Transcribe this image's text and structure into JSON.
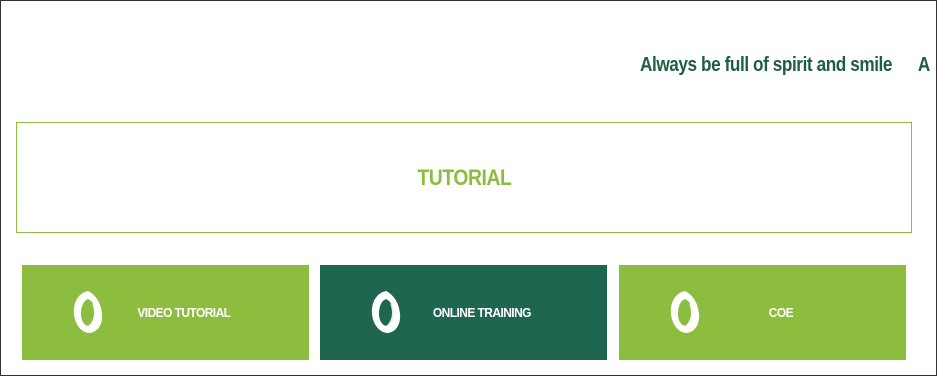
{
  "colors": {
    "accent_green": "#8cbd3f",
    "dark_green": "#1f6650",
    "ticker_text": "#1f5e40",
    "border_gray": "#333333"
  },
  "ticker": {
    "text": "Always be full of spirit and smile",
    "overflow_text": "A"
  },
  "section": {
    "title": "TUTORIAL"
  },
  "cards": [
    {
      "label": "VIDEO TUTORIAL",
      "icon": "swirl-logo-icon",
      "color": "#8cbd3f"
    },
    {
      "label": "ONLINE TRAINING",
      "icon": "swirl-logo-icon",
      "color": "#1f6650"
    },
    {
      "label": "COE",
      "icon": "swirl-logo-icon",
      "color": "#8cbd3f"
    }
  ]
}
